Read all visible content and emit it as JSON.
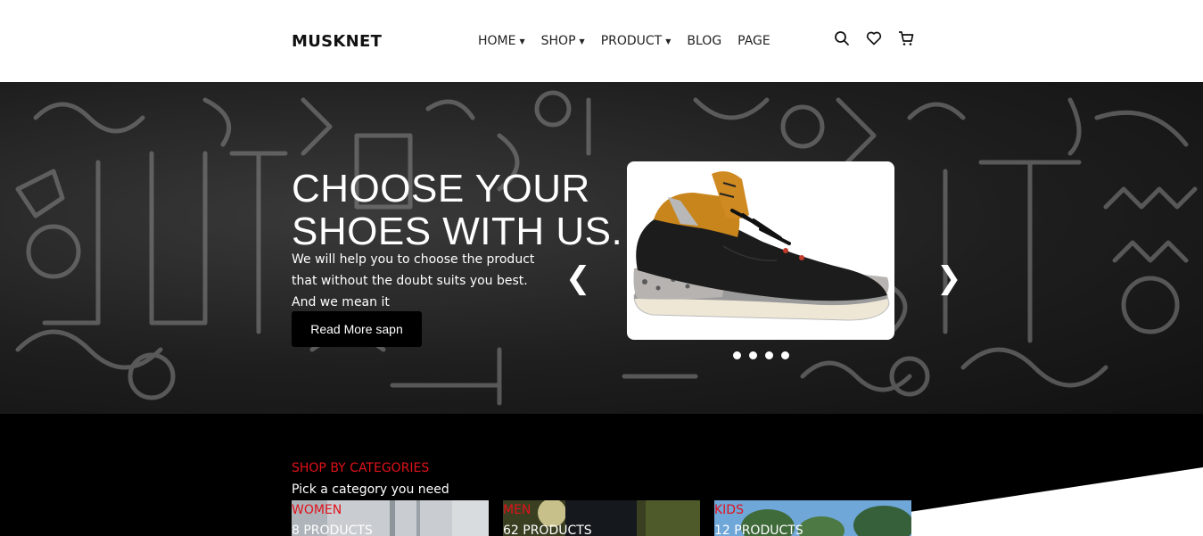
{
  "header": {
    "logo": "MUSKNET",
    "nav": [
      {
        "label": "HOME",
        "has_dropdown": true
      },
      {
        "label": "SHOP",
        "has_dropdown": true
      },
      {
        "label": "PRODUCT",
        "has_dropdown": true
      },
      {
        "label": "BLOG",
        "has_dropdown": false
      },
      {
        "label": "PAGE",
        "has_dropdown": false
      }
    ],
    "icons": [
      "search-icon",
      "heart-icon",
      "cart-icon"
    ]
  },
  "hero": {
    "title_line1": "CHOOSE YOUR",
    "title_line2": "SHOES WITH US.",
    "subtitle_line1": "We will help you to choose the product",
    "subtitle_line2": "that without the doubt suits you best.",
    "subtitle_line3": "And we mean it",
    "button_label": "Read More sapn",
    "prev_arrow": "❮",
    "next_arrow": "❯",
    "slide_count": 4
  },
  "categories": {
    "kicker": "SHOP BY CATEGORIES",
    "title": "Pick a category you need",
    "items": [
      {
        "name": "WOMEN",
        "count": "8 PRODUCTS"
      },
      {
        "name": "MEN",
        "count": "62 PRODUCTS"
      },
      {
        "name": "KIDS",
        "count": "12 PRODUCTS"
      }
    ]
  },
  "colors": {
    "accent_red": "#e0121a",
    "hero_dark": "#1e1e1e",
    "button_black": "#000000"
  }
}
